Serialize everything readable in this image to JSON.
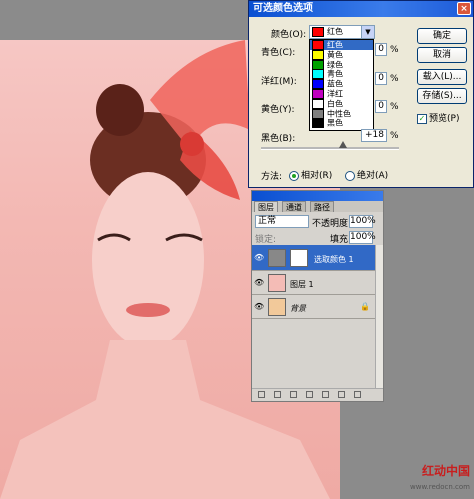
{
  "dialog": {
    "title": "可选颜色选项",
    "close_glyph": "×",
    "colors_label": "颜色(O):",
    "colors_selected": "红色",
    "rows": [
      {
        "label": "青色(C):",
        "value": "0",
        "unit": "%"
      },
      {
        "label": "洋红(M):",
        "value": "0",
        "unit": "%"
      },
      {
        "label": "黄色(Y):",
        "value": "0",
        "unit": "%"
      },
      {
        "label": "黑色(B):",
        "value": "+18",
        "unit": "%"
      }
    ],
    "dropdown_items": [
      {
        "label": "红色",
        "color": "#ff0000",
        "selected": true
      },
      {
        "label": "黄色",
        "color": "#ffff00",
        "selected": false
      },
      {
        "label": "绿色",
        "color": "#00a000",
        "selected": false
      },
      {
        "label": "青色",
        "color": "#00ffff",
        "selected": false
      },
      {
        "label": "蓝色",
        "color": "#0000ff",
        "selected": false
      },
      {
        "label": "洋红",
        "color": "#c000c0",
        "selected": false
      },
      {
        "label": "白色",
        "color": "#ffffff",
        "selected": false
      },
      {
        "label": "中性色",
        "color": "#808080",
        "selected": false
      },
      {
        "label": "黑色",
        "color": "#000000",
        "selected": false
      }
    ],
    "method_label": "方法:",
    "method_relative": "相对(R)",
    "method_absolute": "绝对(A)",
    "method_selected": "relative",
    "buttons": {
      "ok": "确定",
      "cancel": "取消",
      "load": "载入(L)...",
      "save": "存储(S)..."
    },
    "preview_label": "预览(P)",
    "preview_checked": true
  },
  "layers_panel": {
    "tabs": [
      "图层",
      "通道",
      "路径"
    ],
    "blend_mode": "正常",
    "opacity_label": "不透明度:",
    "opacity_value": "100%",
    "lock_label": "锁定:",
    "fill_label": "填充:",
    "fill_value": "100%",
    "layers": [
      {
        "name": "选取颜色 1",
        "active": true
      },
      {
        "name": "图层 1",
        "active": false
      },
      {
        "name": "背景",
        "active": false
      }
    ]
  },
  "watermark": {
    "text": "红动中国",
    "url": "www.redocn.com"
  },
  "icons": {
    "eye": "👁",
    "lock": "🔒",
    "check": "✓",
    "chevron": "▼"
  }
}
